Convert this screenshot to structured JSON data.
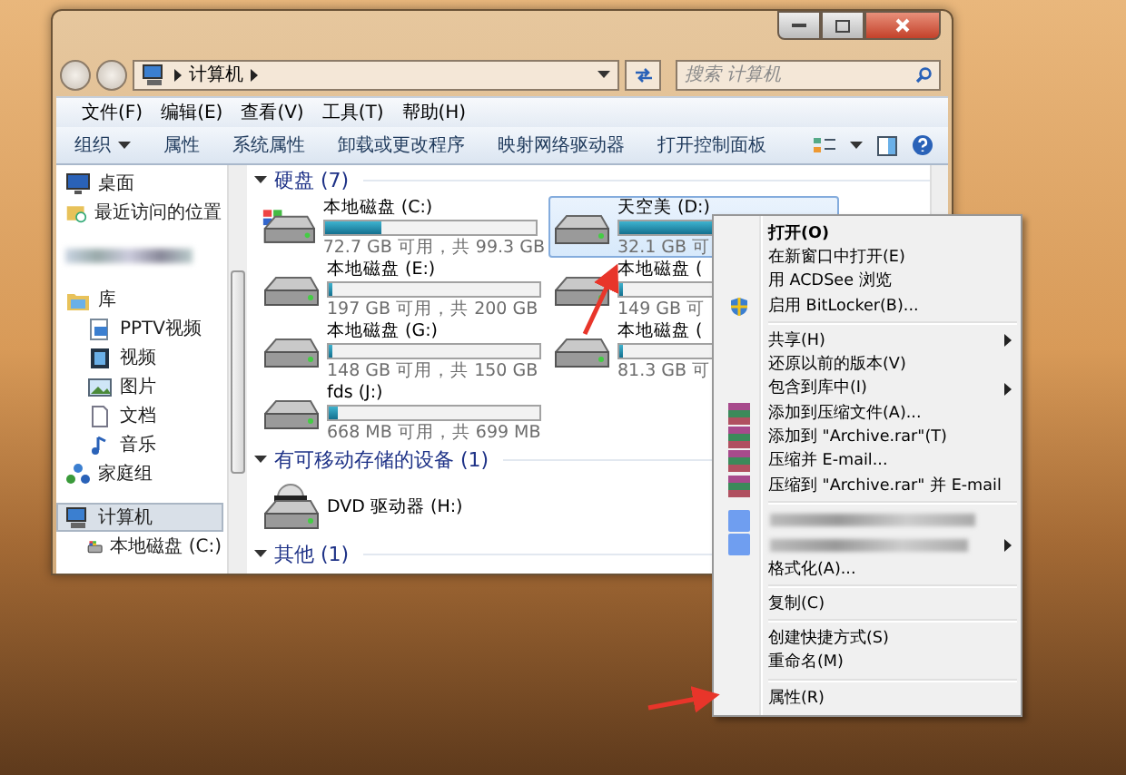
{
  "window": {
    "address": {
      "crumbs": [
        "计算机"
      ]
    },
    "search": {
      "placeholder": "搜索 计算机"
    }
  },
  "menu_bar": [
    "文件(F)",
    "编辑(E)",
    "查看(V)",
    "工具(T)",
    "帮助(H)"
  ],
  "command_bar": [
    {
      "label": "组织",
      "dropdown": true
    },
    {
      "label": "属性",
      "dropdown": false
    },
    {
      "label": "系统属性",
      "dropdown": false
    },
    {
      "label": "卸载或更改程序",
      "dropdown": false
    },
    {
      "label": "映射网络驱动器",
      "dropdown": false
    },
    {
      "label": "打开控制面板",
      "dropdown": false
    }
  ],
  "sidebar": {
    "items": [
      {
        "kind": "item",
        "label": "桌面",
        "selected": false
      },
      {
        "kind": "item",
        "label": "最近访问的位置",
        "selected": false
      },
      {
        "kind": "blurred",
        "selected": false
      },
      {
        "kind": "item",
        "label": "库",
        "selected": false,
        "children": [
          {
            "kind": "item",
            "label": "PPTV视频",
            "selected": false
          },
          {
            "kind": "item",
            "label": "视频",
            "selected": false
          },
          {
            "kind": "item",
            "label": "图片",
            "selected": false
          },
          {
            "kind": "item",
            "label": "文档",
            "selected": false
          },
          {
            "kind": "item",
            "label": "音乐",
            "selected": false
          }
        ]
      },
      {
        "kind": "item",
        "label": "家庭组",
        "selected": false
      },
      {
        "kind": "item",
        "label": "计算机",
        "selected": true,
        "children": [
          {
            "kind": "item",
            "label": "本地磁盘 (C:)",
            "selected": false
          }
        ]
      }
    ]
  },
  "sections": [
    {
      "title": "硬盘 (7)",
      "drives": [
        {
          "kind": "system",
          "name": "本地磁盘 (C:)",
          "free": "72.7 GB 可用，共 99.3 GB",
          "level": 0.27,
          "selected": false
        },
        {
          "kind": "hdd",
          "name": "天空美 (D:)",
          "free": "32.1 GB 可",
          "level": 0.7,
          "selected": true
        },
        {
          "kind": "hdd",
          "name": "本地磁盘 (E:)",
          "free": "197 GB 可用，共 200 GB",
          "level": 0.015,
          "selected": false
        },
        {
          "kind": "hdd",
          "name": "本地磁盘 (",
          "free": "149 GB 可",
          "level": 0.02,
          "selected": false
        },
        {
          "kind": "hdd",
          "name": "本地磁盘 (G:)",
          "free": "148 GB 可用，共 150 GB",
          "level": 0.013,
          "selected": false
        },
        {
          "kind": "hdd",
          "name": "本地磁盘 (",
          "free": "81.3 GB 可",
          "level": 0.02,
          "selected": false
        },
        {
          "kind": "hdd",
          "name": "fds (J:)",
          "free": "668 MB 可用，共 699 MB",
          "level": 0.044,
          "selected": false
        }
      ]
    },
    {
      "title": "有可移动存储的设备 (1)",
      "drives": [
        {
          "kind": "optical",
          "name": "DVD 驱动器 (H:)",
          "selected": false
        }
      ]
    },
    {
      "title": "其他 (1)"
    }
  ],
  "context_menu": {
    "items": [
      {
        "kind": "item",
        "label": "打开(O)",
        "default": true,
        "submenu": false
      },
      {
        "kind": "item",
        "label": "在新窗口中打开(E)",
        "default": false,
        "submenu": false
      },
      {
        "kind": "item",
        "label": "用 ACDSee 浏览",
        "default": false,
        "submenu": false
      },
      {
        "kind": "shield_item",
        "label": "启用 BitLocker(B)...",
        "default": false,
        "submenu": false
      },
      {
        "kind": "separator"
      },
      {
        "kind": "item",
        "label": "共享(H)",
        "default": false,
        "submenu": true
      },
      {
        "kind": "item",
        "label": "还原以前的版本(V)",
        "default": false,
        "submenu": false
      },
      {
        "kind": "item",
        "label": "包含到库中(I)",
        "default": false,
        "submenu": true
      },
      {
        "kind": "archive_item",
        "label": "添加到压缩文件(A)...",
        "default": false,
        "submenu": false
      },
      {
        "kind": "archive_item",
        "label": "添加到 \"Archive.rar\"(T)",
        "default": false,
        "submenu": false
      },
      {
        "kind": "archive_item",
        "label": "压缩并 E-mail...",
        "default": false,
        "submenu": false
      },
      {
        "kind": "archive_item",
        "label": "压缩到 \"Archive.rar\" 并 E-mail",
        "default": false,
        "submenu": false
      },
      {
        "kind": "separator"
      },
      {
        "kind": "blurred",
        "submenu": false
      },
      {
        "kind": "blurred",
        "submenu": true
      },
      {
        "kind": "item",
        "label": "格式化(A)...",
        "default": false,
        "submenu": false
      },
      {
        "kind": "separator"
      },
      {
        "kind": "item",
        "label": "复制(C)",
        "default": false,
        "submenu": false
      },
      {
        "kind": "separator"
      },
      {
        "kind": "item",
        "label": "创建快捷方式(S)",
        "default": false,
        "submenu": false
      },
      {
        "kind": "item",
        "label": "重命名(M)",
        "default": false,
        "submenu": false
      },
      {
        "kind": "separator"
      },
      {
        "kind": "item",
        "label": "属性(R)",
        "default": false,
        "submenu": false
      }
    ]
  }
}
